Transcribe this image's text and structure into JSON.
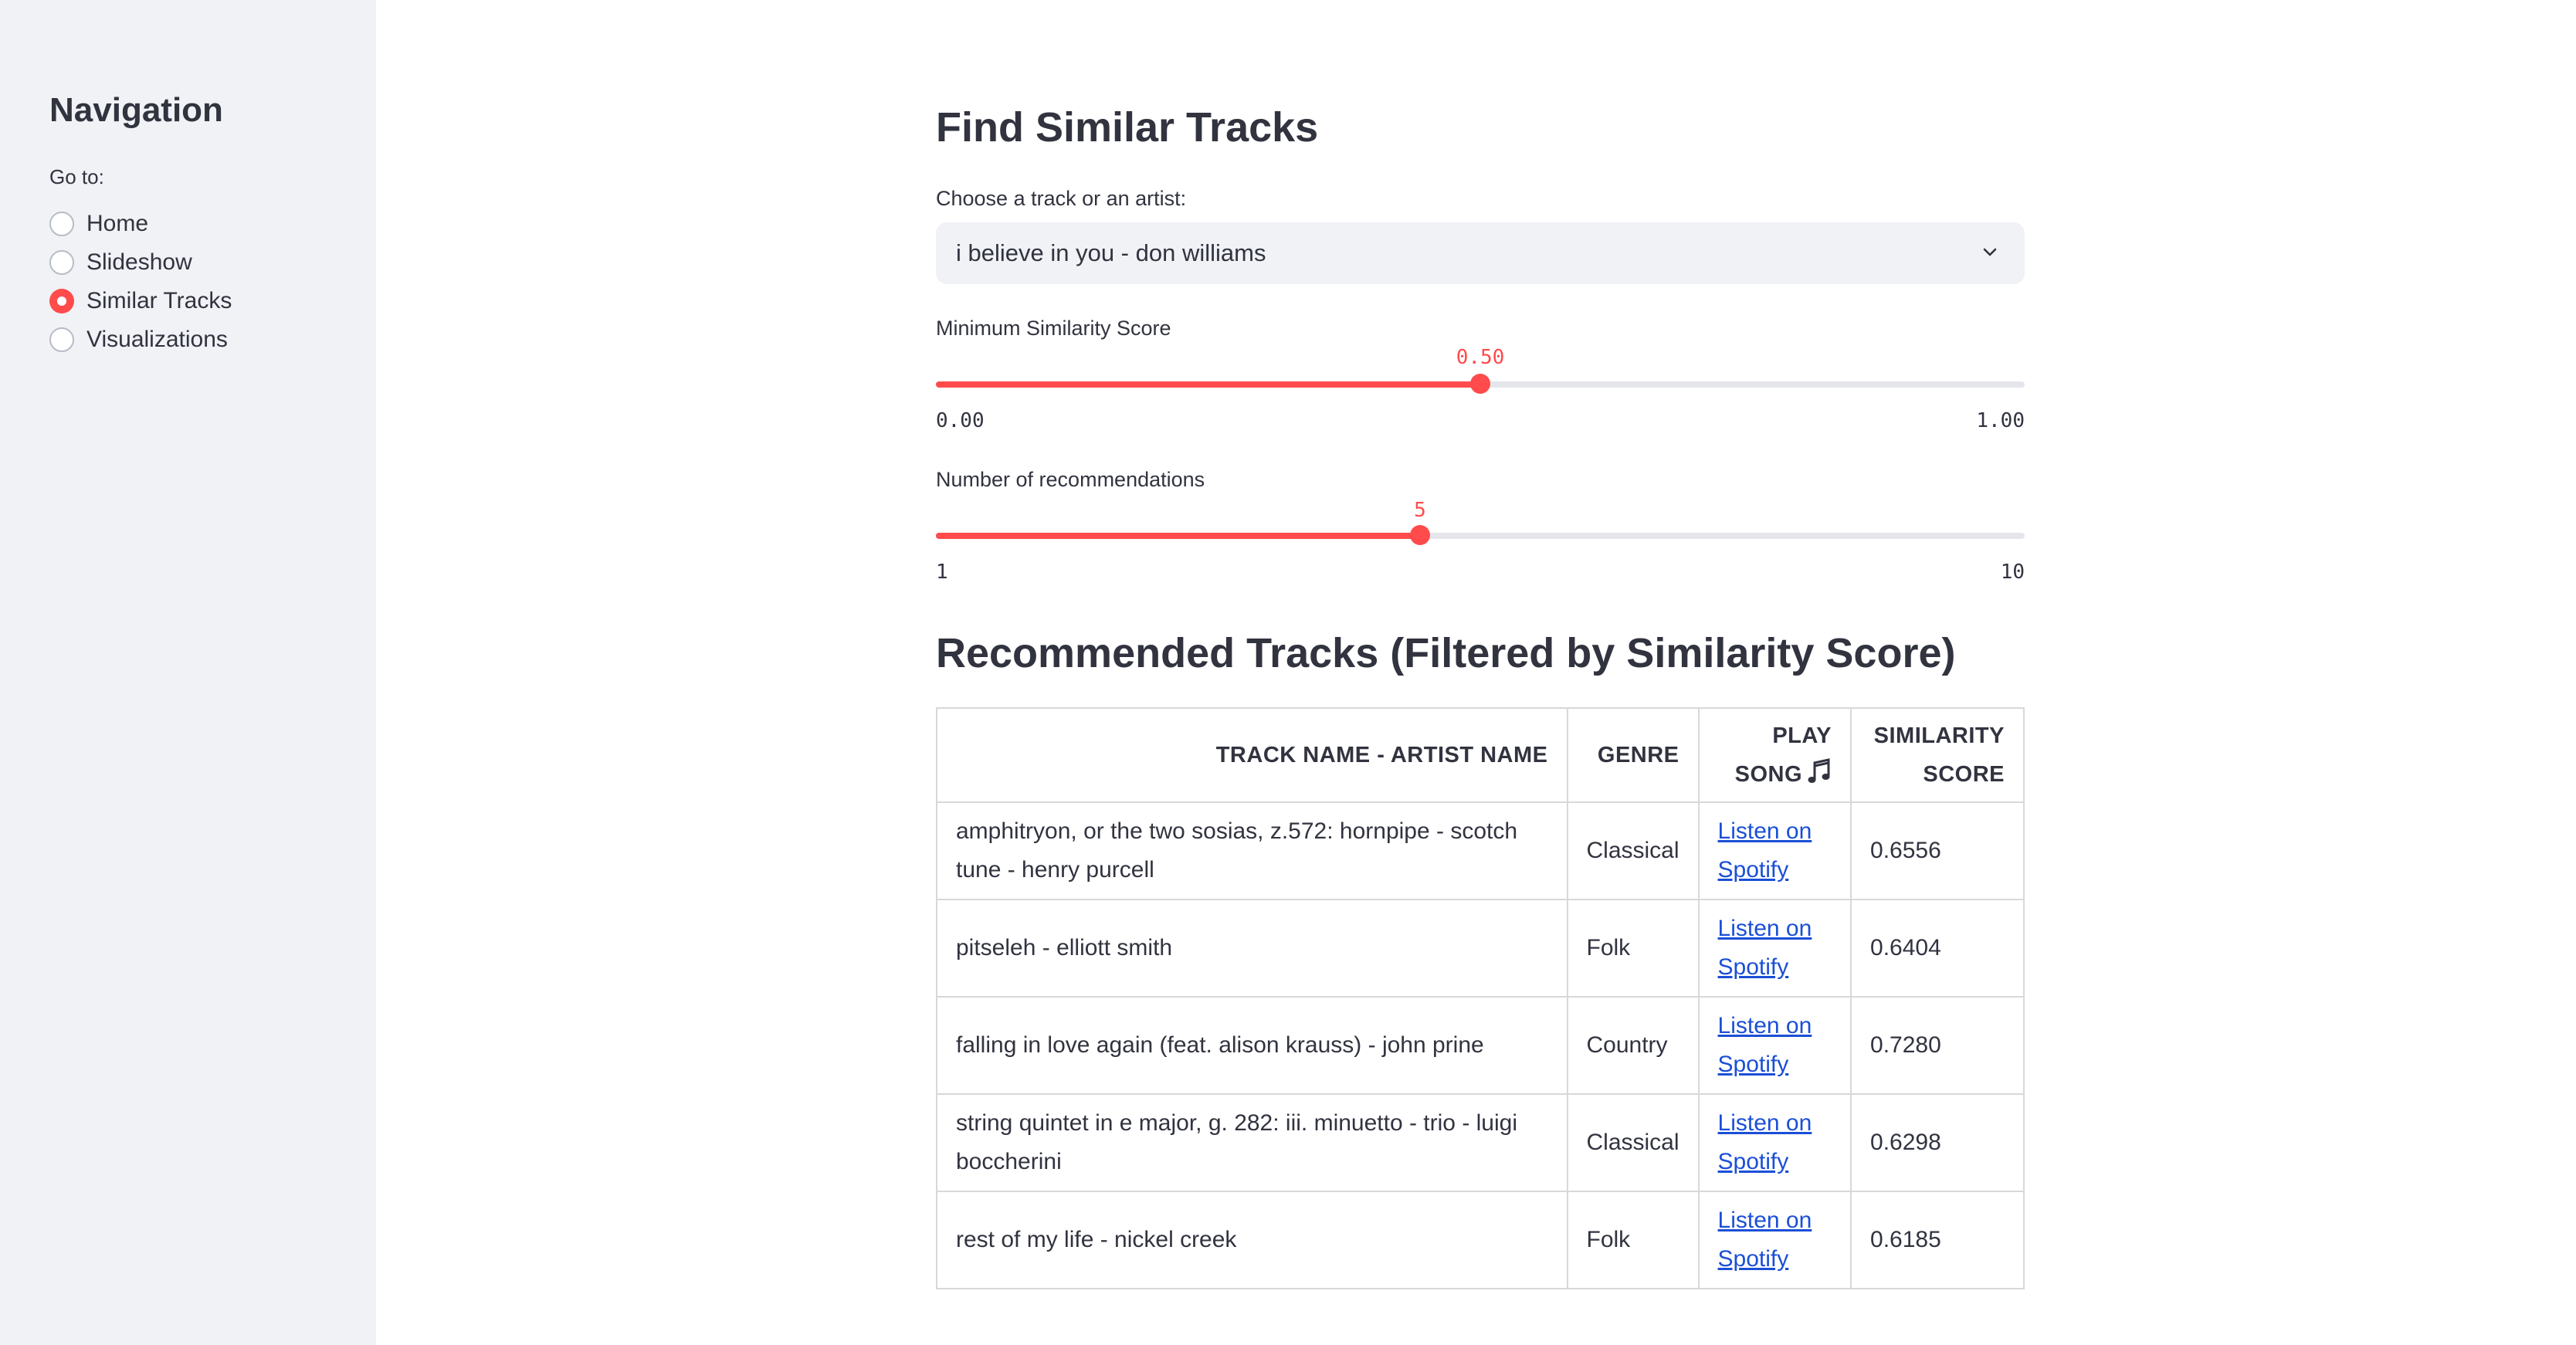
{
  "sidebar": {
    "title": "Navigation",
    "goto_label": "Go to:",
    "options": [
      {
        "label": "Home",
        "selected": false
      },
      {
        "label": "Slideshow",
        "selected": false
      },
      {
        "label": "Similar Tracks",
        "selected": true
      },
      {
        "label": "Visualizations",
        "selected": false
      }
    ]
  },
  "main": {
    "title": "Find Similar Tracks",
    "select": {
      "label": "Choose a track or an artist:",
      "value": "i believe in you - don williams"
    },
    "similarity_slider": {
      "label": "Minimum Similarity Score",
      "value": 0.5,
      "value_text": "0.50",
      "min_text": "0.00",
      "max_text": "1.00",
      "fraction": 0.5
    },
    "count_slider": {
      "label": "Number of recommendations",
      "value": 5,
      "value_text": "5",
      "min_text": "1",
      "max_text": "10",
      "fraction": 0.4444
    },
    "section_title": "Recommended Tracks (Filtered by Similarity Score)",
    "table": {
      "headers": {
        "track": "Track Name - Artist Name",
        "genre": "Genre",
        "play_line1": "Play",
        "play_line2": "Song",
        "score_line1": "Similarity",
        "score_line2": "Score"
      },
      "rows": [
        {
          "track": "amphitryon, or the two sosias, z.572: hornpipe - scotch tune - henry purcell",
          "genre": "Classical",
          "link_line1": "Listen on",
          "link_line2": "Spotify",
          "score": "0.6556"
        },
        {
          "track": "pitseleh - elliott smith",
          "genre": "Folk",
          "link_line1": "Listen on",
          "link_line2": "Spotify",
          "score": "0.6404"
        },
        {
          "track": "falling in love again (feat. alison krauss) - john prine",
          "genre": "Country",
          "link_line1": "Listen on",
          "link_line2": "Spotify",
          "score": "0.7280"
        },
        {
          "track": "string quintet in e major, g. 282: iii. minuetto - trio - luigi boccherini",
          "genre": "Classical",
          "link_line1": "Listen on",
          "link_line2": "Spotify",
          "score": "0.6298"
        },
        {
          "track": "rest of my life - nickel creek",
          "genre": "Folk",
          "link_line1": "Listen on",
          "link_line2": "Spotify",
          "score": "0.6185"
        }
      ]
    }
  },
  "colors": {
    "accent": "#ff4b4b",
    "sidebar_bg": "#f0f2f6",
    "text": "#31333f",
    "link": "#1a4fd6"
  },
  "icons": {
    "dropdown": "chevron-down-icon",
    "play_header": "music-note-icon"
  }
}
